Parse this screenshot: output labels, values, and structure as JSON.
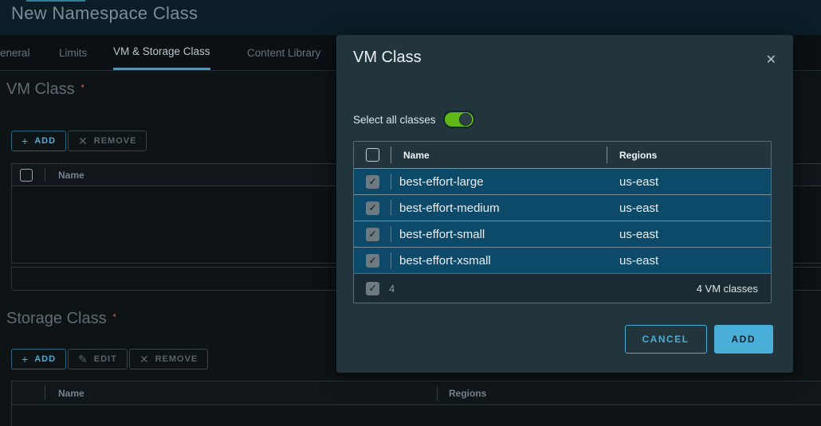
{
  "page": {
    "title": "New Namespace Class",
    "tabs": [
      {
        "label": "eneral",
        "active": false
      },
      {
        "label": "Limits",
        "active": false
      },
      {
        "label": "VM & Storage Class",
        "active": true
      },
      {
        "label": "Content Library",
        "active": false
      }
    ],
    "vm_class_section": {
      "heading": "VM Class",
      "required_marker": "•",
      "add_label": "ADD",
      "remove_label": "REMOVE",
      "add_icon": "+",
      "remove_icon": "✕",
      "table": {
        "name_header": "Name"
      }
    },
    "storage_class_section": {
      "heading": "Storage Class",
      "required_marker": "•",
      "add_label": "ADD",
      "edit_label": "EDIT",
      "remove_label": "REMOVE",
      "add_icon": "+",
      "edit_icon": "✎",
      "remove_icon": "✕",
      "table": {
        "name_header": "Name",
        "regions_header": "Regions"
      }
    }
  },
  "modal": {
    "title": "VM Class",
    "close_icon": "✕",
    "select_all_label": "Select all classes",
    "toggle_state": "on",
    "table": {
      "headers": {
        "name": "Name",
        "regions": "Regions"
      },
      "check_glyph": "✓",
      "rows": [
        {
          "name": "best-effort-large",
          "regions": "us-east",
          "selected": true
        },
        {
          "name": "best-effort-medium",
          "regions": "us-east",
          "selected": true
        },
        {
          "name": "best-effort-small",
          "regions": "us-east",
          "selected": true
        },
        {
          "name": "best-effort-xsmall",
          "regions": "us-east",
          "selected": true
        }
      ],
      "footer": {
        "selected_count": "4",
        "total_label": "4 VM classes"
      }
    },
    "buttons": {
      "cancel": "CANCEL",
      "add": "ADD"
    }
  },
  "colors": {
    "accent_blue": "#49afd9",
    "toggle_green": "#5eb715",
    "selected_row_blue": "#0d4a6a",
    "required_red": "#9e4f43",
    "modal_bg": "#22343c",
    "header_teal": "#0b1e27",
    "tab_underline": "#3d9dc2"
  }
}
